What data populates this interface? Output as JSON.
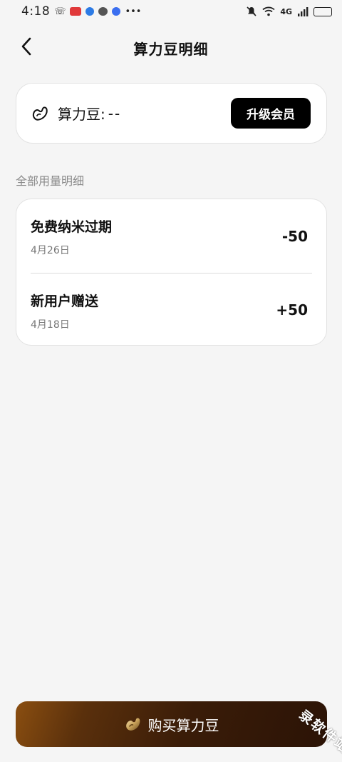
{
  "status_bar": {
    "time": "4:18",
    "network": "4G"
  },
  "header": {
    "title": "算力豆明细"
  },
  "balance": {
    "label": "算力豆:",
    "value": "--",
    "upgrade_label": "升级会员"
  },
  "section": {
    "title": "全部用量明细"
  },
  "records": [
    {
      "name": "免费纳米过期",
      "date": "4月26日",
      "amount": "-50"
    },
    {
      "name": "新用户赠送",
      "date": "4月18日",
      "amount": "+50"
    }
  ],
  "footer": {
    "buy_label": "购买算力豆"
  },
  "watermark": {
    "text": "录软件站"
  },
  "colors": {
    "background": "#f5f5f5",
    "card": "#ffffff",
    "button_dark": "#000000",
    "buy_gradient_start": "#8a4e10",
    "buy_gradient_end": "#2b1306"
  }
}
